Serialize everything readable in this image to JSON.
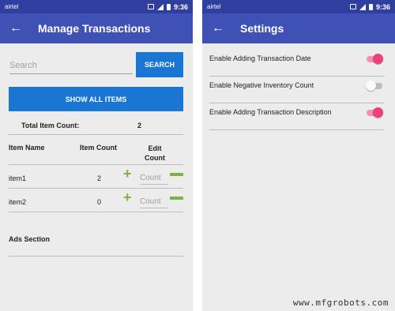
{
  "left_screen": {
    "status": {
      "carrier": "airtel",
      "time": "9:36"
    },
    "appbar": {
      "title": "Manage Transactions"
    },
    "search": {
      "placeholder": "Search",
      "button_label": "SEARCH"
    },
    "show_all_label": "SHOW ALL ITEMS",
    "total": {
      "label": "Total Item Count:",
      "value": "2"
    },
    "table": {
      "headers": {
        "name": "Item Name",
        "count": "Item Count",
        "edit_line1": "Edit",
        "edit_line2": "Count"
      },
      "rows": [
        {
          "name": "item1",
          "count": "2",
          "edit_placeholder": "Count"
        },
        {
          "name": "item2",
          "count": "0",
          "edit_placeholder": "Count"
        }
      ]
    },
    "ads_label": "Ads Section"
  },
  "right_screen": {
    "status": {
      "carrier": "airtel",
      "time": "9:36"
    },
    "appbar": {
      "title": "Settings"
    },
    "settings": [
      {
        "label": "Enable Adding Transaction Date",
        "enabled": true
      },
      {
        "label": "Enable Negative Inventory Count",
        "enabled": false
      },
      {
        "label": "Enable Adding Transaction Description",
        "enabled": true
      }
    ]
  },
  "watermark": "www.mfgrobots.com",
  "colors": {
    "statusbar": "#303f9f",
    "appbar": "#3f51b5",
    "button": "#1976d2",
    "accent_green": "#7cb342",
    "toggle_on": "#ec407a"
  },
  "icons": {
    "back": "arrow-left-icon",
    "add": "plus-icon",
    "remove": "minus-icon"
  }
}
